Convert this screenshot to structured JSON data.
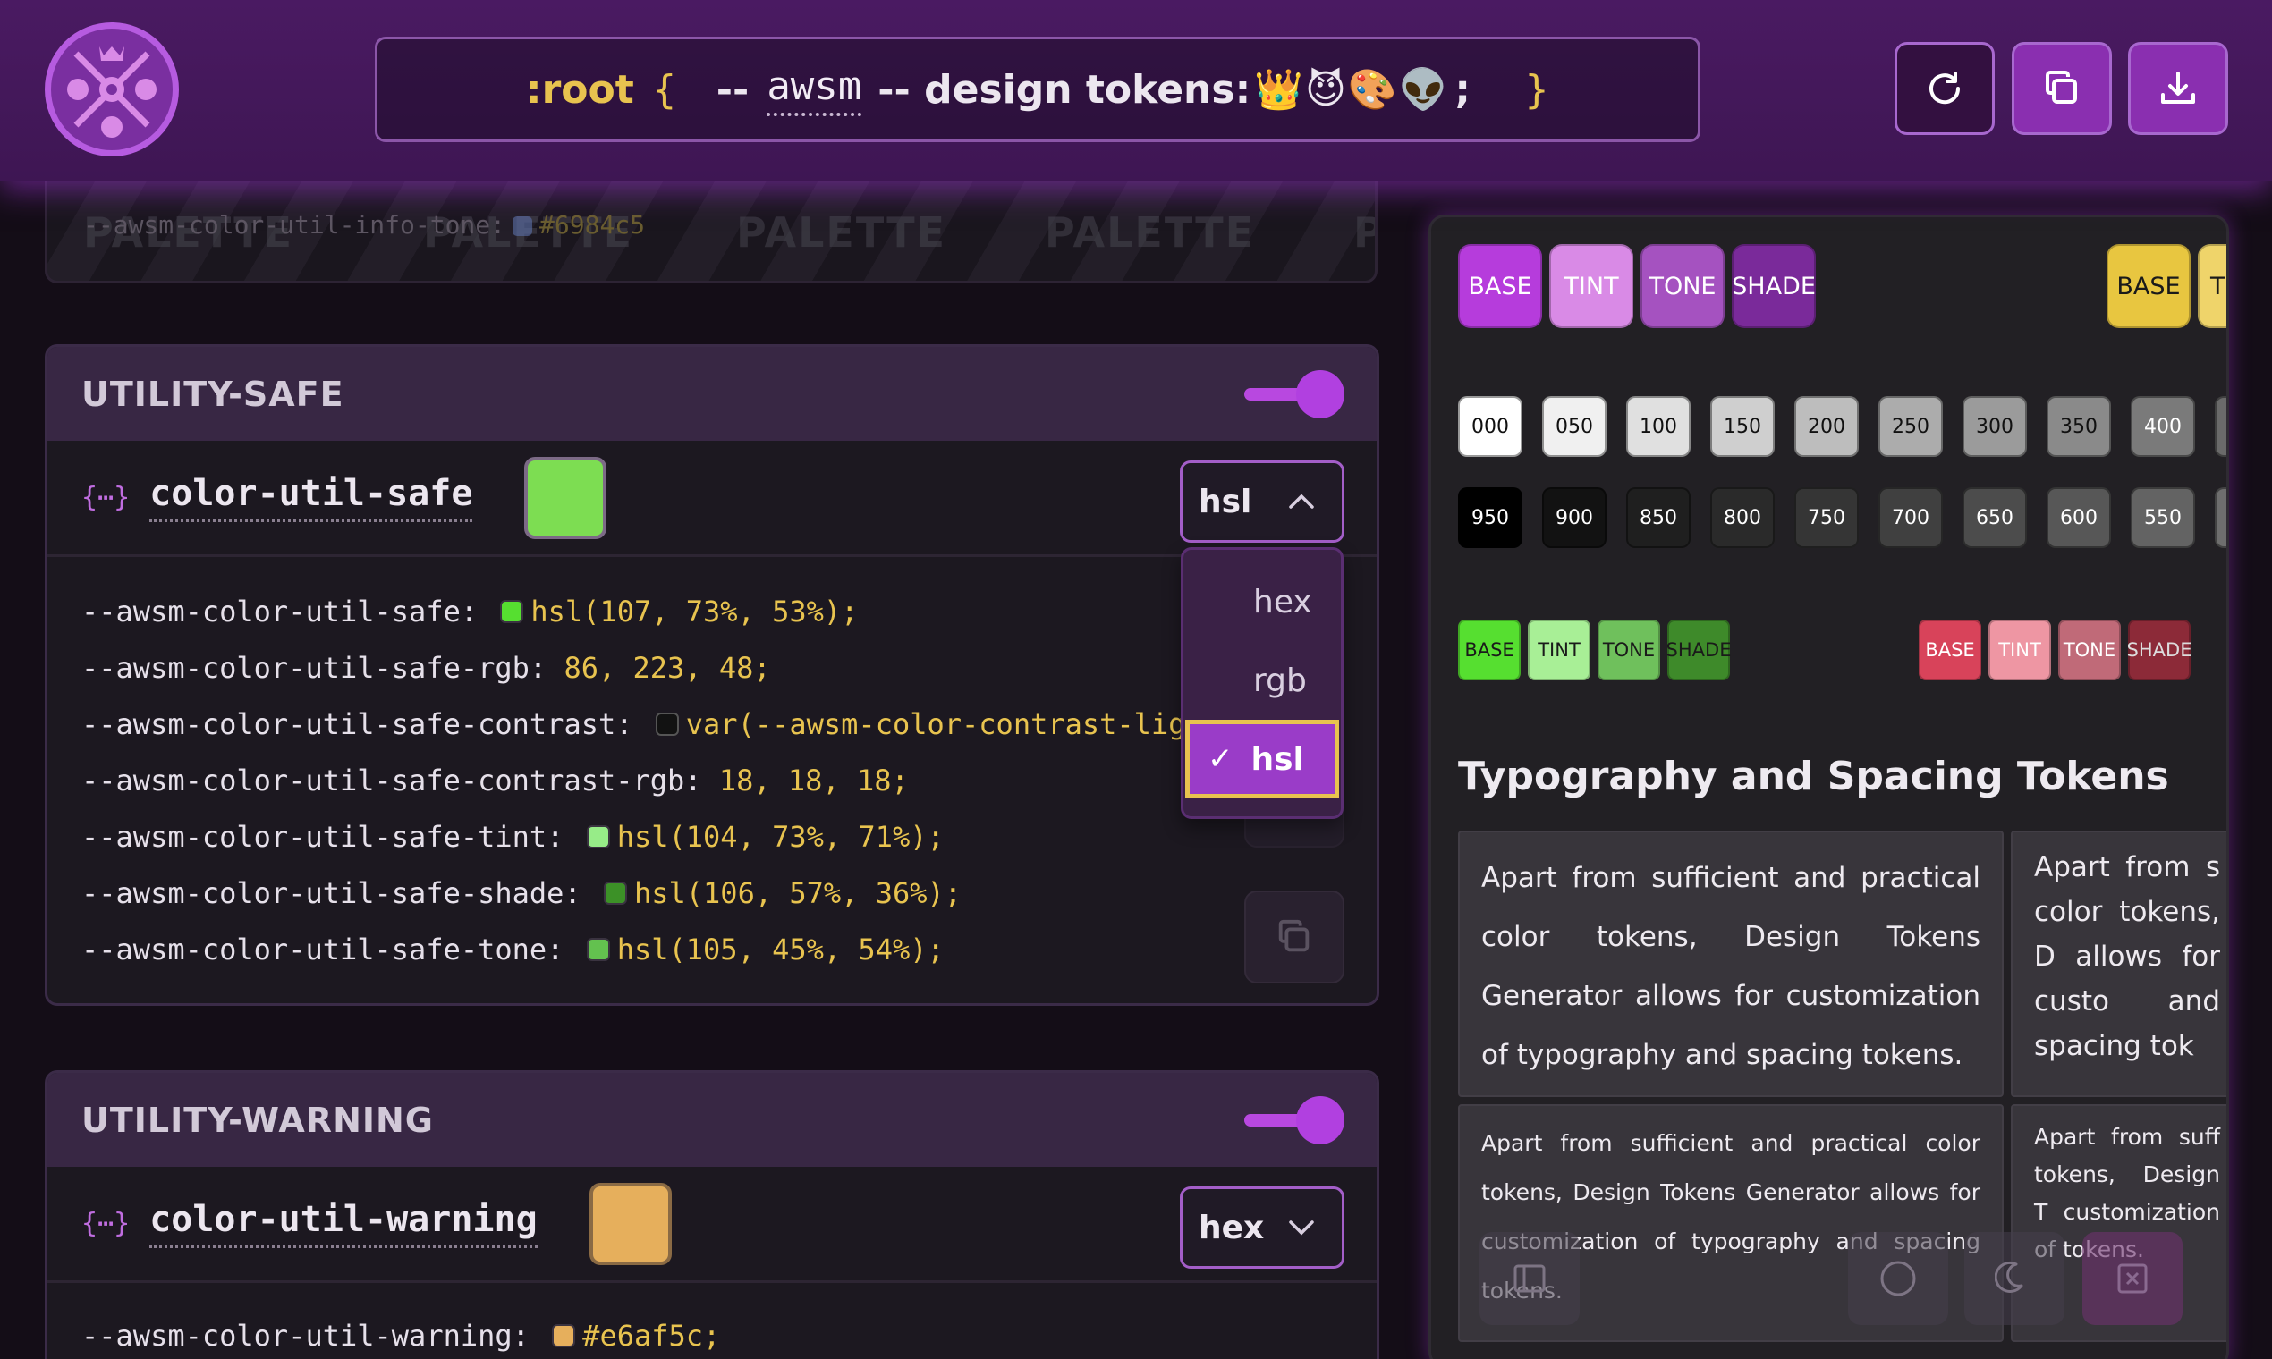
{
  "header": {
    "root_keyword": ":root",
    "open_brace": "{",
    "dash": "--",
    "prefix": "awsm",
    "label": "-- design tokens:",
    "emojis": "👑😈🎨👽",
    "semicolon": ";",
    "close_brace": "}",
    "buttons": [
      "refresh-icon",
      "copy-icon",
      "download-icon"
    ]
  },
  "ghost_card": {
    "code_prefix": "--awsm-color-util-info-tone:",
    "code_value": "#6984c5",
    "watermark": "PALETTE"
  },
  "cards": [
    {
      "title": "UTILITY-SAFE",
      "enabled": true,
      "token_name": "color-util-safe",
      "swatch_color": "#56df30",
      "format": "hsl",
      "format_options": [
        "hex",
        "rgb",
        "hsl"
      ],
      "lines": [
        {
          "prop": "--awsm-color-util-safe:",
          "value": "hsl(107, 73%, 53%);",
          "swatch": "#56df30"
        },
        {
          "prop": "--awsm-color-util-safe-rgb:",
          "value": "86, 223, 48;"
        },
        {
          "prop": "--awsm-color-util-safe-contrast:",
          "value": "var(--awsm-color-contrast-ligh",
          "swatch": "#121212"
        },
        {
          "prop": "--awsm-color-util-safe-contrast-rgb:",
          "value": "18, 18, 18;"
        },
        {
          "prop": "--awsm-color-util-safe-tint:",
          "value": "hsl(104, 73%, 71%);",
          "swatch": "#97ec88"
        },
        {
          "prop": "--awsm-color-util-safe-shade:",
          "value": "hsl(106, 57%, 36%);",
          "swatch": "#3c9127"
        },
        {
          "prop": "--awsm-color-util-safe-tone:",
          "value": "hsl(105, 45%, 54%);",
          "swatch": "#63c14f"
        }
      ]
    },
    {
      "title": "UTILITY-WARNING",
      "enabled": true,
      "token_name": "color-util-warning",
      "swatch_color": "#e6af5c",
      "format": "hex",
      "lines": [
        {
          "prop": "--awsm-color-util-warning:",
          "value": "#e6af5c;",
          "swatch": "#e6af5c"
        }
      ]
    }
  ],
  "panel": {
    "purple_pills": [
      "BASE",
      "TINT",
      "TONE",
      "SHADE"
    ],
    "yellow_pills": [
      "BASE",
      "T"
    ],
    "gray_scale_light": [
      "000",
      "050",
      "100",
      "150",
      "200",
      "250",
      "300",
      "350",
      "400"
    ],
    "gray_scale_dark": [
      "950",
      "900",
      "850",
      "800",
      "750",
      "700",
      "650",
      "600",
      "550"
    ],
    "green_minis": [
      "BASE",
      "TINT",
      "TONE",
      "SHADE"
    ],
    "red_minis": [
      "BASE",
      "TINT",
      "TONE",
      "SHADE"
    ],
    "typography_title": "Typography and Spacing Tokens",
    "typo_text_1": "Apart from sufficient and practical color tokens, Design Tokens Generator allows for customization of typography and spacing tokens.",
    "typo_text_2": "Apart from s color tokens, D allows for custo and spacing tok",
    "typo_text_3": "Apart from sufficient and practical color tokens, Design Tokens Generator allows for customization of typography and spacing tokens.",
    "typo_text_4": "Apart from suff tokens, Design T customization of tokens.",
    "colors": {
      "purple_base": "#b63cdc",
      "purple_tint": "#d98ae6",
      "purple_tone": "#a552c0",
      "purple_shade": "#7a2a9a",
      "yellow": "#e8c640",
      "green_base": "#56df30",
      "green_tint": "#a8ef96",
      "green_tone": "#6fc05c",
      "green_shade": "#3e8a2a",
      "red_base": "#d8435a",
      "red_tint": "#ee96a3",
      "red_tone": "#c06a78",
      "red_shade": "#8c2a38"
    }
  }
}
